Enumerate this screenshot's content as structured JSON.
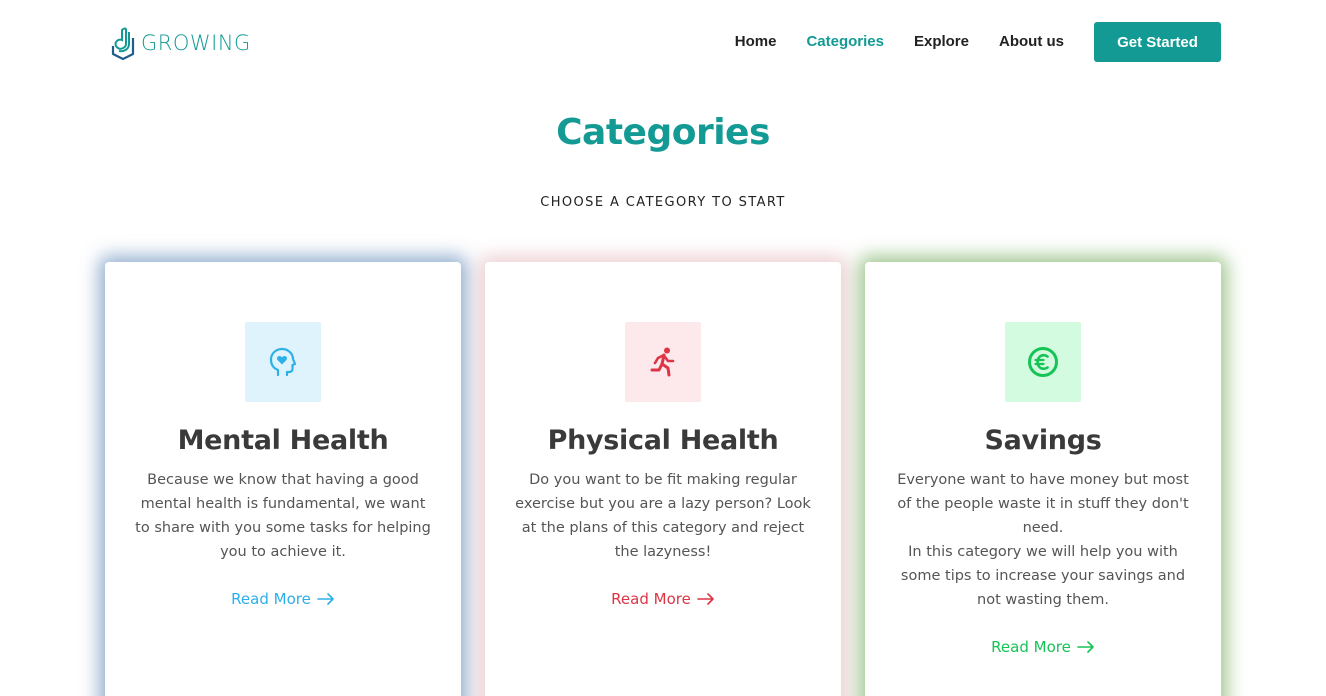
{
  "brand": {
    "name": "GROWING",
    "color": "#139a94"
  },
  "nav": {
    "items": [
      {
        "label": "Home",
        "active": false
      },
      {
        "label": "Categories",
        "active": true
      },
      {
        "label": "Explore",
        "active": false
      },
      {
        "label": "About us",
        "active": false
      }
    ],
    "cta_label": "Get Started"
  },
  "section": {
    "title": "Categories",
    "subtitle": "CHOOSE A CATEGORY TO START"
  },
  "cards": [
    {
      "title": "Mental Health",
      "description": "Because we know that having a good mental health is fundamental, we want to share with you some tasks for helping you to achieve it.",
      "link_label": "Read More",
      "icon": "head-heart-icon",
      "accent": "#2cb0e8"
    },
    {
      "title": "Physical Health",
      "description": "Do you want to be fit making regular exercise but you are a lazy person? Look at the plans of this category and reject the lazyness!",
      "link_label": "Read More",
      "icon": "running-person-icon",
      "accent": "#dd3545"
    },
    {
      "title": "Savings",
      "description": "Everyone want to have money but most of the people waste it in stuff they don't need.\nIn this category we will help you with some tips to increase your savings and not wasting them.",
      "link_label": "Read More",
      "icon": "euro-coin-icon",
      "accent": "#16c456"
    }
  ]
}
